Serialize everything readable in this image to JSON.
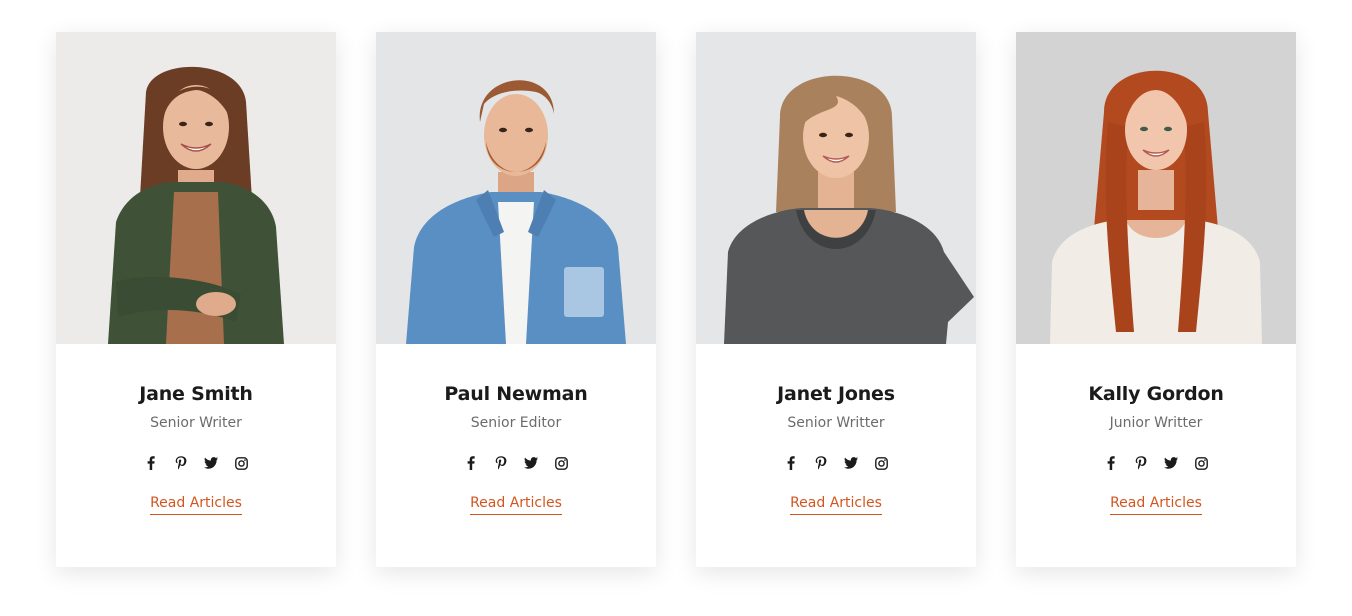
{
  "team": [
    {
      "name": "Jane Smith",
      "role": "Senior Writer",
      "link_label": "Read Articles",
      "photo_subject": "woman with long brown hair in green shirt",
      "colors": {
        "bg": "#ecebea",
        "hair": "#6b3d25",
        "skin": "#e9b99b",
        "shirt": "#3f5238",
        "inner": "#a86f4c"
      }
    },
    {
      "name": "Paul Newman",
      "role": "Senior Editor",
      "link_label": "Read Articles",
      "photo_subject": "man with beard in denim shirt",
      "colors": {
        "bg": "#e4e5e7",
        "hair": "#9b5a33",
        "skin": "#e8b898",
        "shirt": "#5a8fc3",
        "inner": "#f4f4f2"
      }
    },
    {
      "name": "Janet Jones",
      "role": "Senior Writter",
      "link_label": "Read Articles",
      "photo_subject": "woman with short blonde hair in grey t-shirt",
      "colors": {
        "bg": "#e4e6e8",
        "hair": "#a9825d",
        "skin": "#eec3a6",
        "shirt": "#555759",
        "inner": "#555759"
      }
    },
    {
      "name": "Kally Gordon",
      "role": "Junior Writter",
      "link_label": "Read Articles",
      "photo_subject": "woman with long red hair in white t-shirt",
      "colors": {
        "bg": "#d3d3d3",
        "hair": "#b34a1f",
        "skin": "#f1c6ad",
        "shirt": "#f1ece6",
        "inner": "#f1ece6"
      }
    }
  ],
  "social_icons": [
    "facebook-icon",
    "pinterest-icon",
    "twitter-icon",
    "instagram-icon"
  ],
  "accent_color": "#d2561f"
}
